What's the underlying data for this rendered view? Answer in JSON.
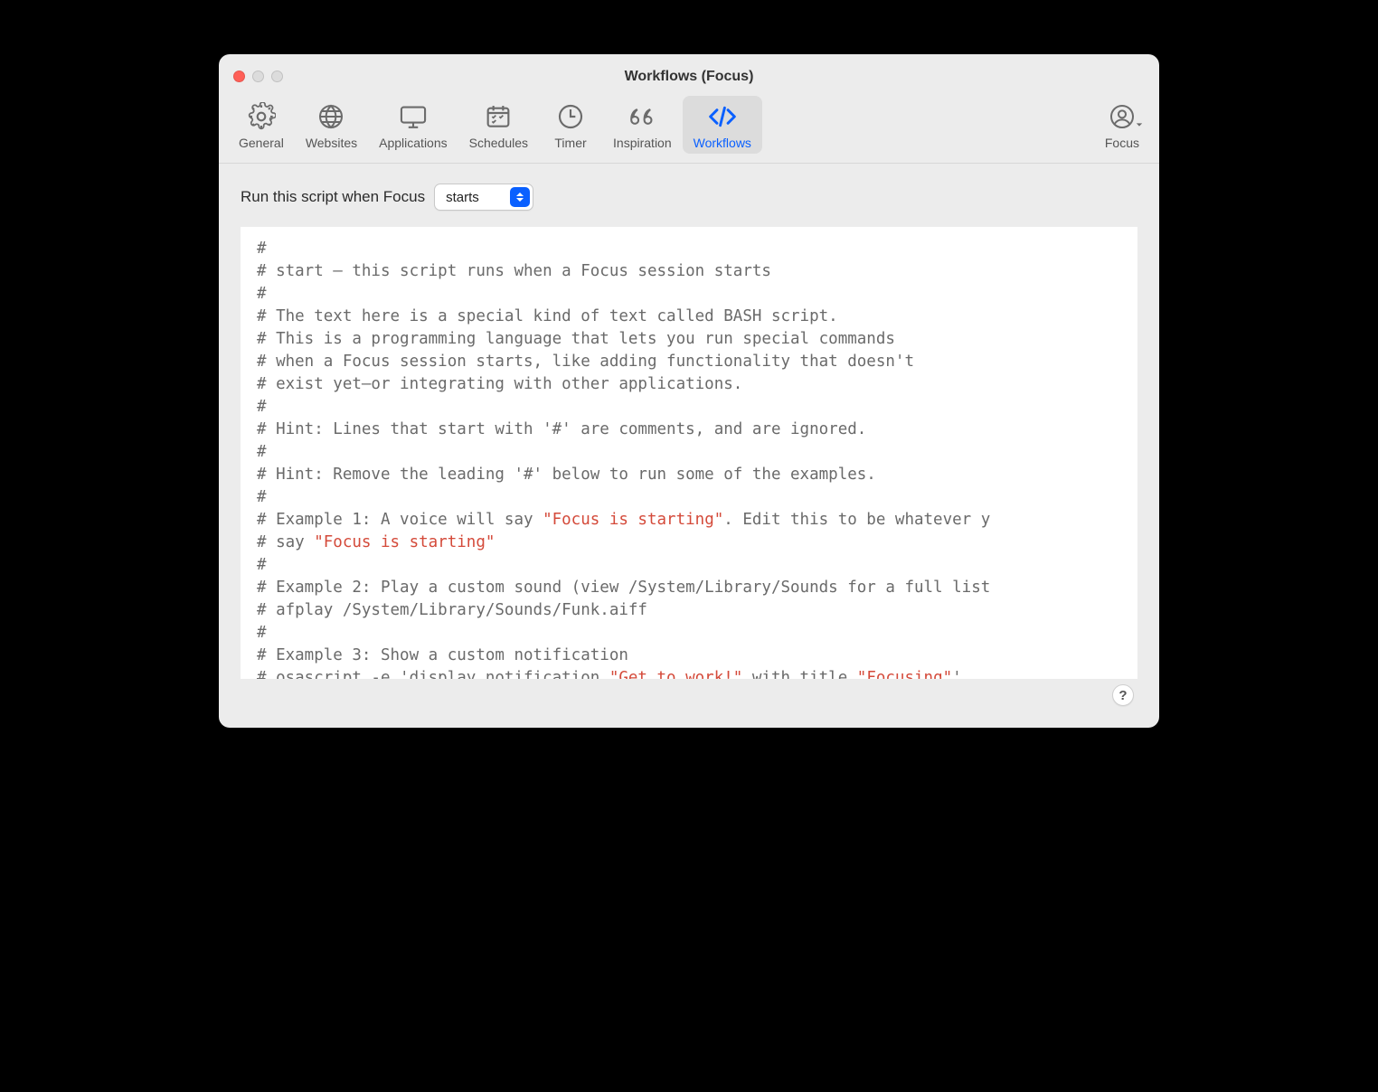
{
  "window": {
    "title": "Workflows (Focus)"
  },
  "toolbar": {
    "tabs": [
      {
        "id": "general",
        "label": "General",
        "icon": "gear-icon"
      },
      {
        "id": "websites",
        "label": "Websites",
        "icon": "globe-icon"
      },
      {
        "id": "applications",
        "label": "Applications",
        "icon": "display-icon"
      },
      {
        "id": "schedules",
        "label": "Schedules",
        "icon": "calendar-icon"
      },
      {
        "id": "timer",
        "label": "Timer",
        "icon": "clock-icon"
      },
      {
        "id": "inspiration",
        "label": "Inspiration",
        "icon": "quotes-icon"
      },
      {
        "id": "workflows",
        "label": "Workflows",
        "icon": "code-icon",
        "active": true
      }
    ],
    "account_label": "Focus"
  },
  "body": {
    "run_label": "Run this script when Focus",
    "select_value": "starts",
    "help": "?"
  },
  "script": {
    "lines": [
      {
        "segments": [
          {
            "t": "#"
          }
        ]
      },
      {
        "segments": [
          {
            "t": "# start — this script runs when a Focus session starts"
          }
        ]
      },
      {
        "segments": [
          {
            "t": "#"
          }
        ]
      },
      {
        "segments": [
          {
            "t": "# The text here is a special kind of text called BASH script."
          }
        ]
      },
      {
        "segments": [
          {
            "t": "# This is a programming language that lets you run special commands"
          }
        ]
      },
      {
        "segments": [
          {
            "t": "# when a Focus session starts, like adding functionality that doesn't"
          }
        ]
      },
      {
        "segments": [
          {
            "t": "# exist yet—or integrating with other applications."
          }
        ]
      },
      {
        "segments": [
          {
            "t": "#"
          }
        ]
      },
      {
        "segments": [
          {
            "t": "# Hint: Lines that start with '#' are comments, and are ignored."
          }
        ]
      },
      {
        "segments": [
          {
            "t": "#"
          }
        ]
      },
      {
        "segments": [
          {
            "t": "# Hint: Remove the leading '#' below to run some of the examples."
          }
        ]
      },
      {
        "segments": [
          {
            "t": "#"
          }
        ]
      },
      {
        "segments": [
          {
            "t": "# Example 1: A voice will say "
          },
          {
            "t": "\"Focus is starting\"",
            "c": "str"
          },
          {
            "t": ". Edit this to be whatever y"
          }
        ]
      },
      {
        "segments": [
          {
            "t": "# say "
          },
          {
            "t": "\"Focus is starting\"",
            "c": "str"
          }
        ]
      },
      {
        "segments": [
          {
            "t": "#"
          }
        ]
      },
      {
        "segments": [
          {
            "t": "# Example 2: Play a custom sound (view /System/Library/Sounds for a full list"
          }
        ]
      },
      {
        "segments": [
          {
            "t": "# afplay /System/Library/Sounds/Funk.aiff"
          }
        ]
      },
      {
        "segments": [
          {
            "t": "#"
          }
        ]
      },
      {
        "segments": [
          {
            "t": "# Example 3: Show a custom notification"
          }
        ]
      },
      {
        "segments": [
          {
            "t": "# osascript -e 'display notification "
          },
          {
            "t": "\"Get to work!\"",
            "c": "str"
          },
          {
            "t": " with title "
          },
          {
            "t": "\"Focusing\"",
            "c": "str"
          },
          {
            "t": "'"
          }
        ]
      }
    ]
  }
}
